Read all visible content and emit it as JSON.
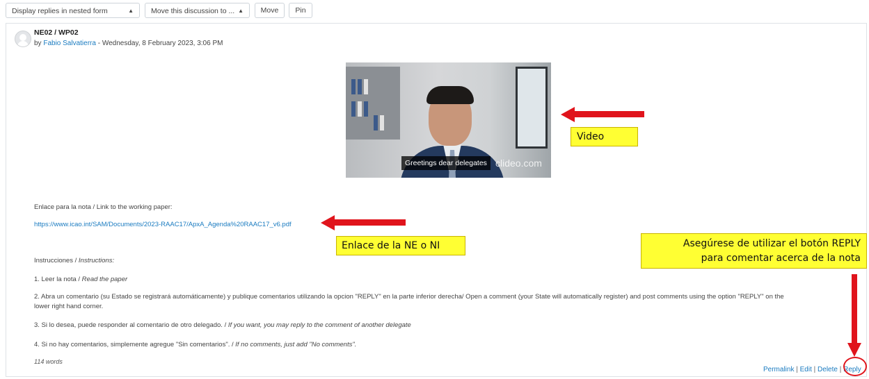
{
  "toolbar": {
    "display_select": "Display replies in nested form",
    "move_select": "Move this discussion to ...",
    "move_label": "Move",
    "pin_label": "Pin"
  },
  "post": {
    "subject": "NE02 / WP02",
    "by_prefix": "by",
    "author": "Fabio Salvatierra",
    "date": "- Wednesday, 8 February 2023, 3:06 PM",
    "video": {
      "caption": "Greetings dear delegates",
      "watermark": "clideo.com"
    },
    "link_intro": "Enlace para la nota / Link to the working paper:",
    "link_url": "https://www.icao.int/SAM/Documents/2023-RAAC17/ApxA_Agenda%20RAAC17_v6.pdf",
    "instructions_es": "Instrucciones / ",
    "instructions_en": "Instructions:",
    "item1_es": "1. Leer la nota / ",
    "item1_en": "Read the paper",
    "item2_line1": "2. Abra un comentario (su Estado se registrará automáticamente) y publique comentarios utilizando la opcion \"REPLY\" en la parte inferior derecha/ Open a comment (your State will automatically register) and post comments using the option \"REPLY\" on the",
    "item2_line2": "lower right hand corner.",
    "item3_es": "3. Si lo desea, puede responder al comentario de otro delegado. / ",
    "item3_en": "If you want, you may reply to the comment of another delegate",
    "item4_es": "4. Si no hay comentarios, simplemente agregue \"Sin comentarios\". / ",
    "item4_en": "If no comments, just add \"No comments\".",
    "word_count": "114 words",
    "actions": {
      "permalink": "Permalink",
      "edit": "Edit",
      "delete": "Delete",
      "reply": "Reply",
      "separator": "|"
    }
  },
  "annotations": {
    "video_label": "Video",
    "link_label": "Enlace de la NE o NI",
    "reply_note_line1": "Asegúrese de utilizar el botón REPLY",
    "reply_note_line2": "para comentar acerca de la nota",
    "arrow_color": "#e0141c",
    "callout_color": "#ffff33"
  }
}
